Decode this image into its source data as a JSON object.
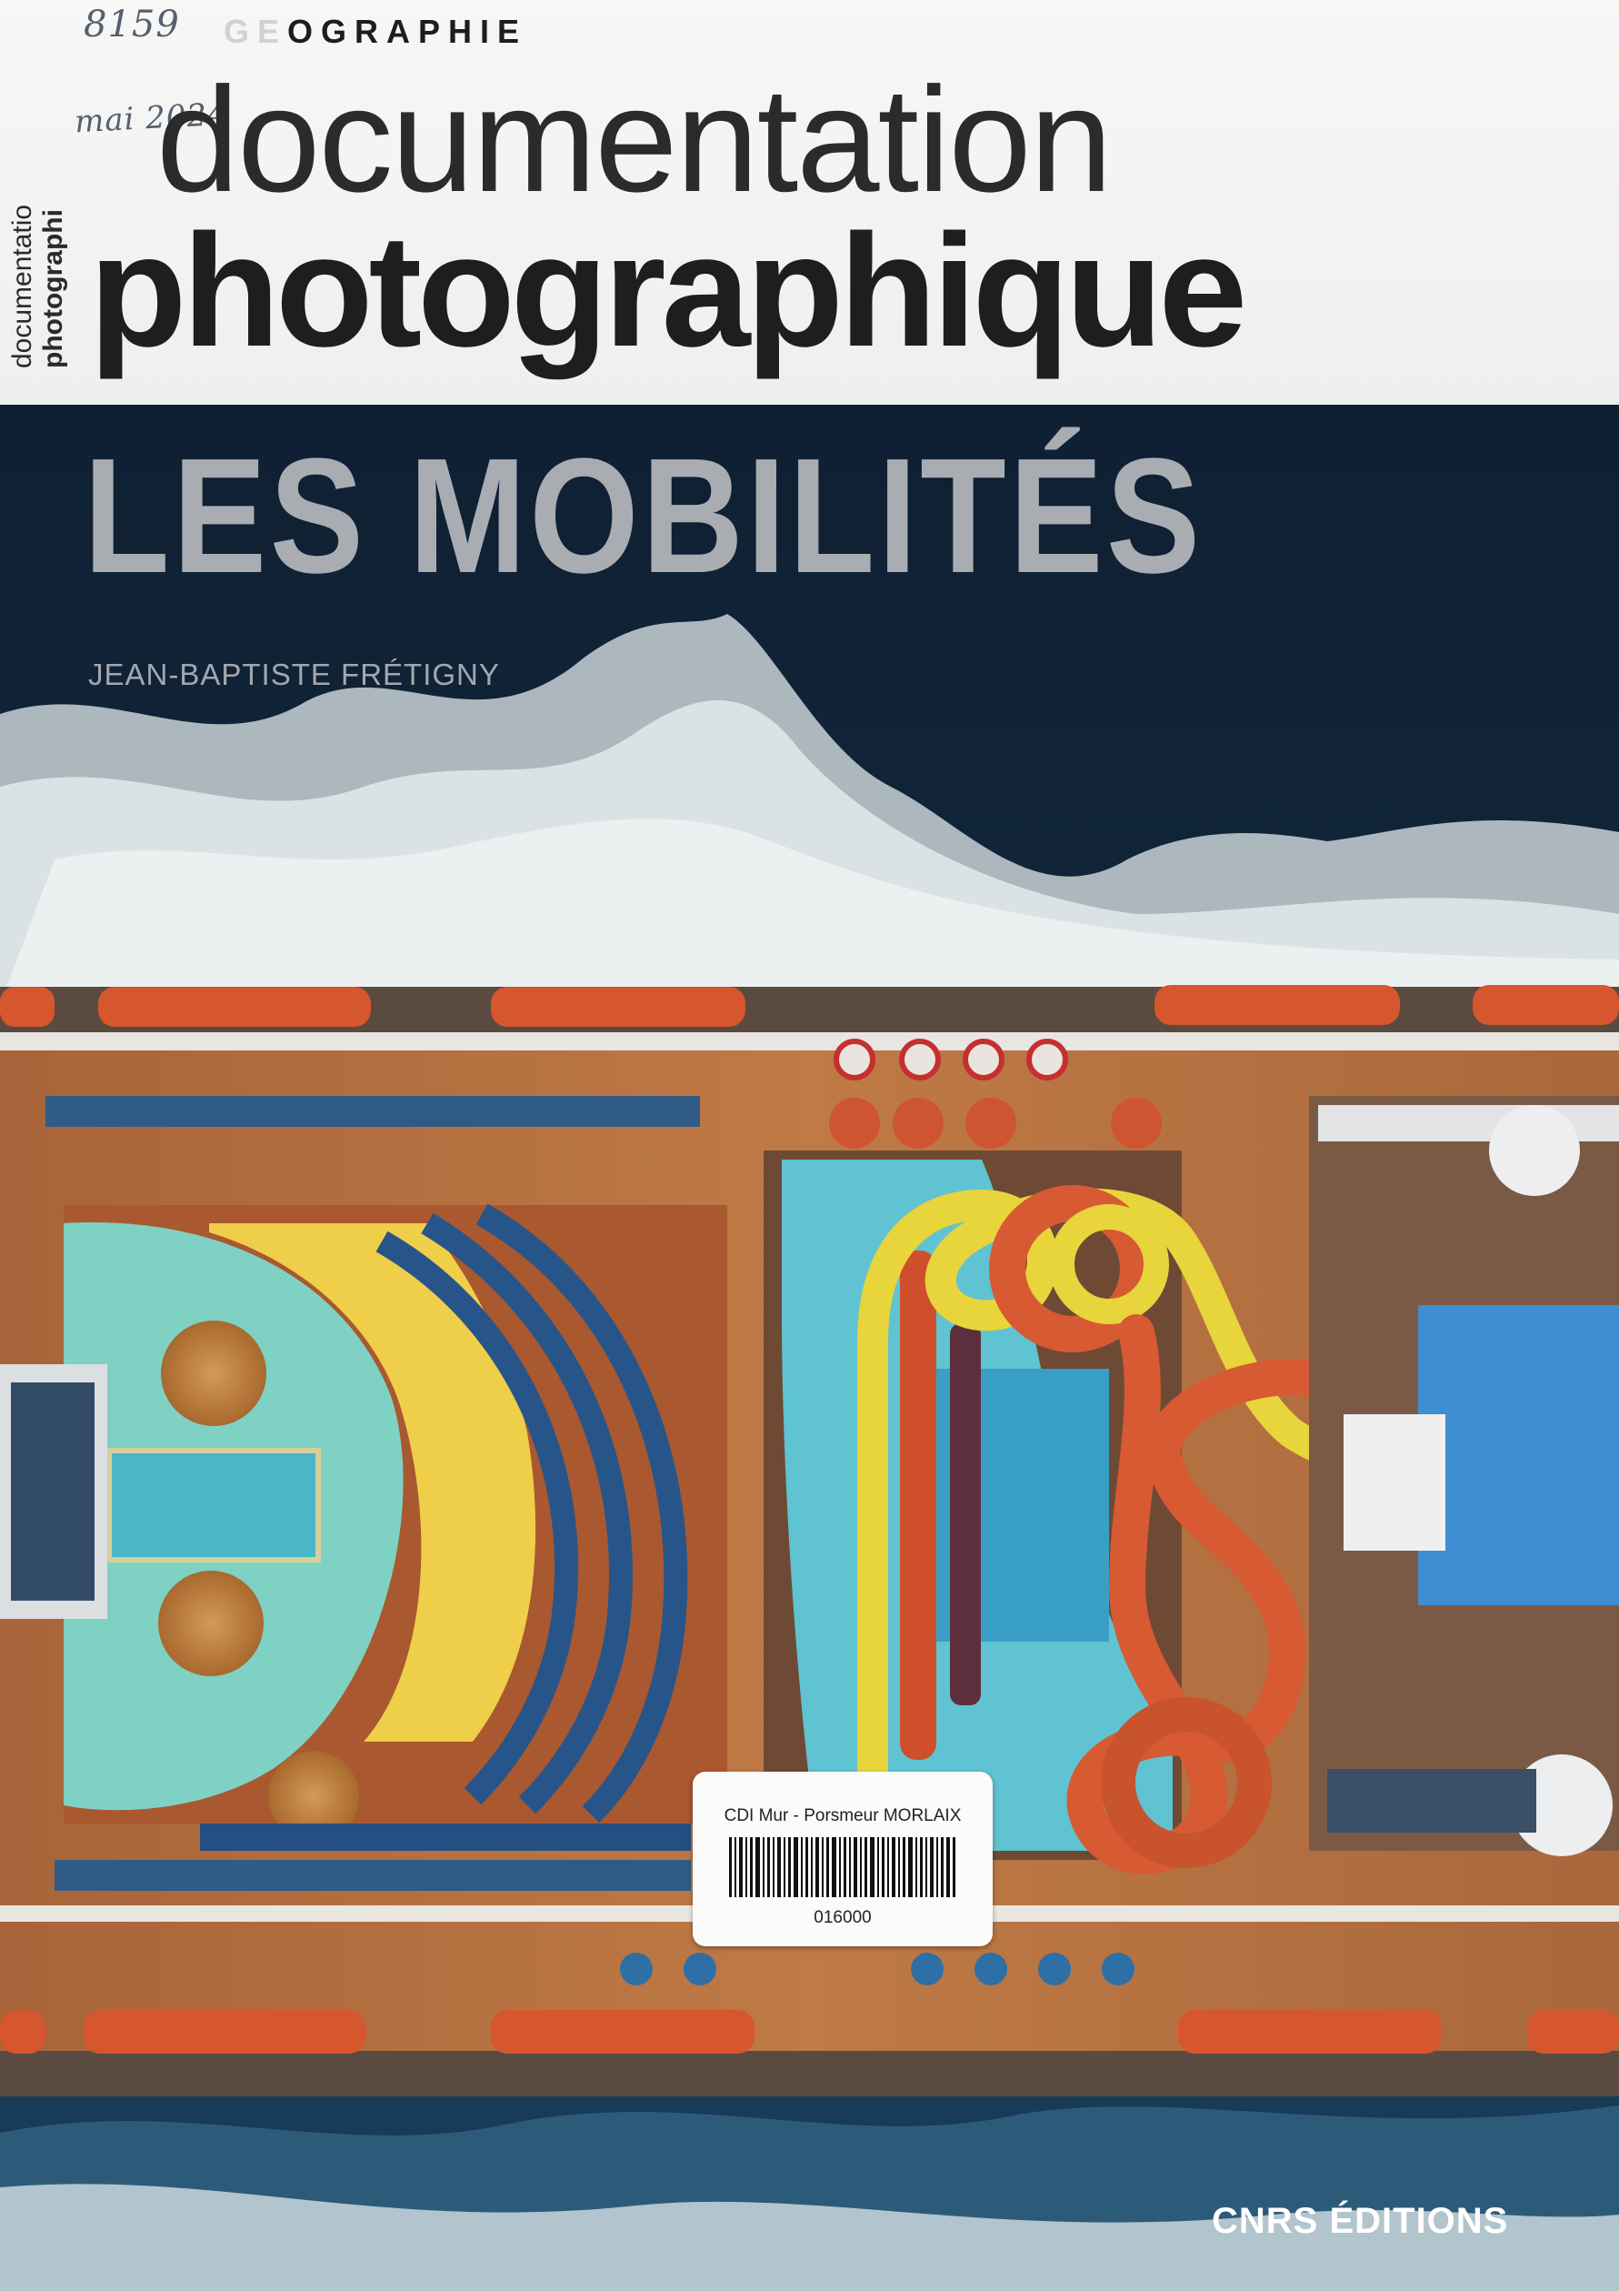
{
  "handwritten": {
    "number": "8159",
    "date": "mai 2024"
  },
  "header": {
    "section_ghost": "GE",
    "section_rest": "OGRAPHIE",
    "spine_line1": "documentatio",
    "spine_line2": "photographi",
    "title_line1": "documentation",
    "title_line2": "photographique"
  },
  "cover": {
    "main_title": "LES MOBILITÉS",
    "author": "JEAN-BAPTISTE FRÉTIGNY"
  },
  "library_label": {
    "owner": "CDI Mur - Porsmeur MORLAIX",
    "code": "016000"
  },
  "publisher": "CNRS ÉDITIONS",
  "colors": {
    "sea_dark": "#122436",
    "deck_brown": "#b8713f",
    "lifeboat_orange": "#d6562d",
    "pool_cyan": "#5fc3d2",
    "slide_yellow": "#e8d43b",
    "title_gray": "#a9adb2"
  },
  "photo_subject": "aerial-view-cruise-ship-deck"
}
